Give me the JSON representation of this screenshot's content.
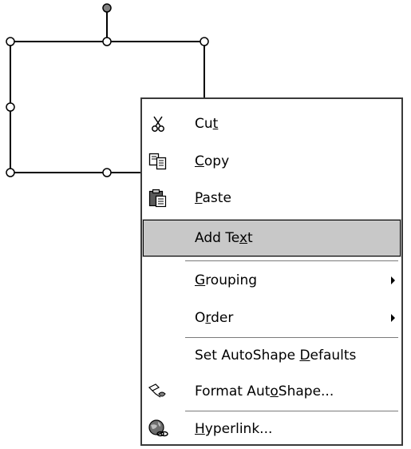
{
  "menu": {
    "items": [
      {
        "id": "cut",
        "pre": "Cu",
        "mn": "t",
        "post": "",
        "icon": "scissors-icon"
      },
      {
        "id": "copy",
        "pre": "",
        "mn": "C",
        "post": "opy",
        "icon": "copy-icon"
      },
      {
        "id": "paste",
        "pre": "",
        "mn": "P",
        "post": "aste",
        "icon": "paste-icon"
      },
      {
        "id": "add-text",
        "pre": "Add Te",
        "mn": "x",
        "post": "t",
        "icon": ""
      },
      {
        "id": "grouping",
        "pre": "",
        "mn": "G",
        "post": "rouping",
        "icon": "",
        "submenu": true
      },
      {
        "id": "order",
        "pre": "O",
        "mn": "r",
        "post": "der",
        "icon": "",
        "submenu": true
      },
      {
        "id": "set-autoshape-defaults",
        "pre": "Set AutoShape ",
        "mn": "D",
        "post": "efaults",
        "icon": ""
      },
      {
        "id": "format-autoshape",
        "pre": "Format Aut",
        "mn": "o",
        "post": "Shape...",
        "icon": "format-painter-icon"
      },
      {
        "id": "hyperlink",
        "pre": "",
        "mn": "H",
        "post": "yperlink...",
        "icon": "hyperlink-globe-icon"
      }
    ],
    "highlighted": "add-text"
  },
  "colors": {
    "highlight": "#c8c8c8",
    "border": "#3a3a3a"
  }
}
